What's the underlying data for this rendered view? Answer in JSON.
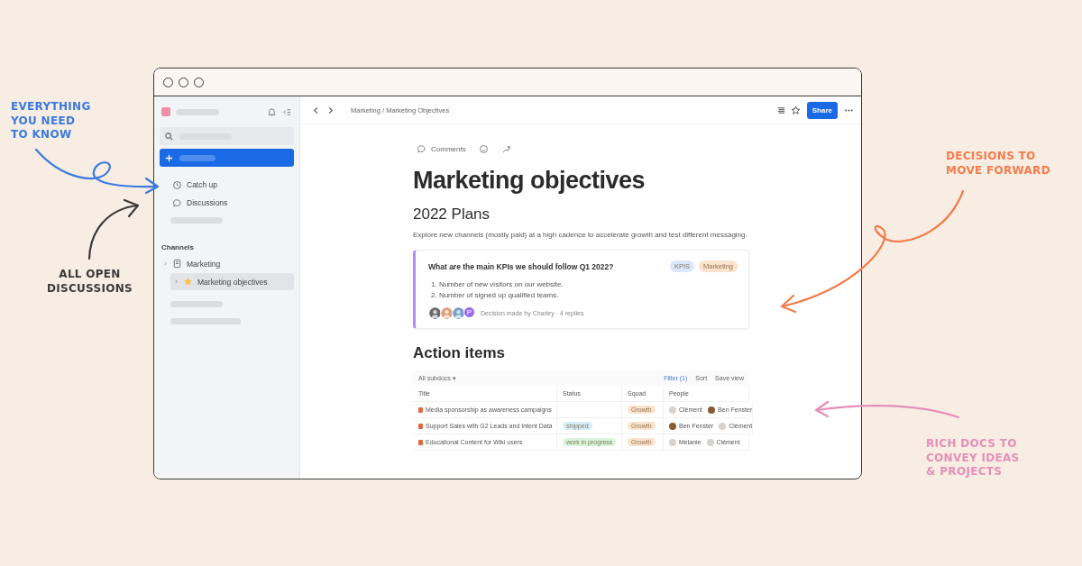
{
  "annotations": [
    {
      "text": "EVERYTHING\nYOU NEED\nTO KNOW",
      "color": "#3b7ae0"
    },
    {
      "text": "ALL OPEN\nDISCUSSIONS",
      "color": "#3a3a3a"
    },
    {
      "text": "DECISIONS TO\nMOVE FORWARD",
      "color": "#f47c4c"
    },
    {
      "text": "RICH DOCS TO\nCONVEY IDEAS\n& PROJECTS",
      "color": "#e58fb8"
    }
  ],
  "sidebar": {
    "nav": [
      {
        "kind": "clock",
        "label": "Catch up"
      },
      {
        "kind": "chat",
        "label": "Discussions"
      }
    ],
    "channels_heading": "Channels",
    "tree": [
      {
        "kind": "doc",
        "label": "Marketing",
        "selected": false,
        "children": [
          {
            "kind": "star",
            "label": "Marketing objectives",
            "selected": true
          }
        ]
      }
    ]
  },
  "topbar": {
    "breadcrumb": "Marketing / Marketing Objectives",
    "share": "Share"
  },
  "doc": {
    "comments": "Comments",
    "title": "Marketing objectives",
    "subtitle": "2022 Plans",
    "intro": "Explore new channels (mostly paid) at a high cadence to accelerate growth and test different messaging.",
    "decision": {
      "question": "What are the main KPIs we should follow Q1 2022?",
      "tags": [
        {
          "label": "KPIS",
          "color": "#dbe8fb"
        },
        {
          "label": "Marketing",
          "color": "#fbe3cc"
        }
      ],
      "items": [
        "1. Number of new visitors on our website.",
        "2. Number of signed up qualified teams."
      ],
      "avatars": [
        {
          "kind": "face",
          "color": "#6b6b6b"
        },
        {
          "kind": "face",
          "color": "#e0a07a"
        },
        {
          "kind": "face",
          "color": "#7a9cc8"
        },
        {
          "kind": "letter",
          "color": "#9b6cf0",
          "letter": "P"
        }
      ],
      "footer": "Decision made by Charley · 4 replies"
    },
    "actions_heading": "Action items",
    "table": {
      "view": "All subdocs ▾",
      "filter": "Filter (1)",
      "sort": "Sort",
      "save": "Save view",
      "columns": [
        "Title",
        "Status",
        "Squad",
        "People"
      ],
      "rows": [
        {
          "title": "Media sponsorship as awareness campaigns",
          "status": null,
          "squad": {
            "label": "Growth",
            "color": "#fbe3cc"
          },
          "people": [
            {
              "name": "Clément",
              "kind": "figure"
            },
            {
              "name": "Ben Fenster",
              "kind": "photo"
            }
          ]
        },
        {
          "title": "Support Sales with G2 Leads and Intent Data",
          "status": {
            "label": "shipped",
            "color": "#d6eefa"
          },
          "squad": {
            "label": "Growth",
            "color": "#fbe3cc"
          },
          "people": [
            {
              "name": "Ben Fenster",
              "kind": "photo"
            },
            {
              "name": "Clément",
              "kind": "figure"
            }
          ]
        },
        {
          "title": "Educational Content for Wiki users",
          "status": {
            "label": "work in progress",
            "color": "#d8f5dc"
          },
          "squad": {
            "label": "Growth",
            "color": "#fbe3cc"
          },
          "people": [
            {
              "name": "Melanie",
              "kind": "figure"
            },
            {
              "name": "Clément",
              "kind": "figure"
            }
          ]
        }
      ]
    }
  }
}
